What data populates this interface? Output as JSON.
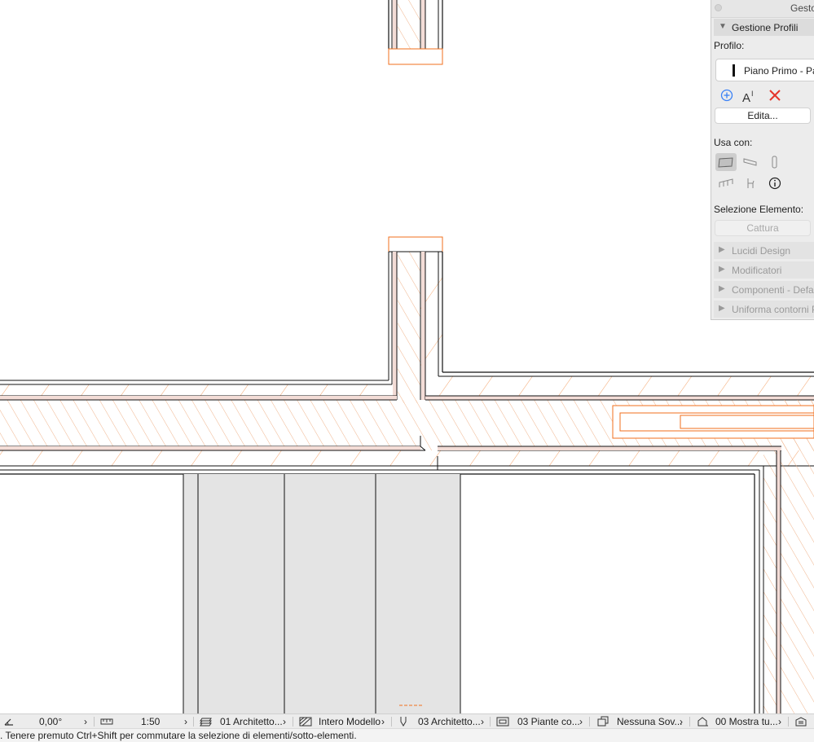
{
  "palette": {
    "window_title": "Gesto",
    "section_title": "Gestione Profili",
    "profile_label": "Profilo:",
    "profile_value": "Piano Primo - Pa",
    "edit_button": "Edita...",
    "use_with_label": "Usa con:",
    "selection_label": "Selezione Elemento:",
    "capture_button": "Cattura",
    "collapsed_sections": [
      "Lucidi Design",
      "Modificatori",
      "Componenti - Defau",
      "Uniforma contorni P"
    ],
    "icons": {
      "add": "add-circle-icon",
      "rename": "rename-text-icon",
      "delete": "delete-x-icon"
    }
  },
  "statusbar": {
    "angle": "0,00°",
    "scale": "1:50",
    "layers": "01 Architetto...",
    "model_view": "Intero Modello",
    "pen_set": "03 Architetto...",
    "view_mode": "03 Piante co...",
    "override": "Nessuna Sov...",
    "renovation": "00 Mostra tu..."
  },
  "message": ". Tenere premuto Ctrl+Shift per commutare la selezione di elementi/sotto-elementi.",
  "colors": {
    "accent_orange": "#f26f1c",
    "hatch": "#f0b48c",
    "wall_fill": "#f3dcd6",
    "room_fill": "#e4e4e4",
    "delete_red": "#e5352b",
    "add_blue": "#3b82f6"
  }
}
